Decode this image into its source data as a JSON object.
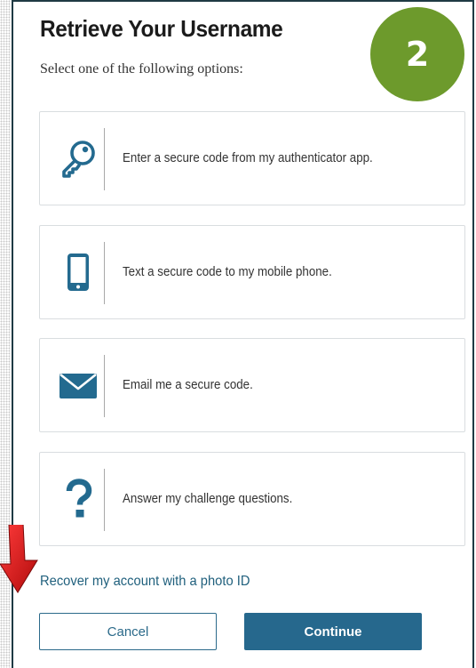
{
  "title": "Retrieve Your Username",
  "subtitle": "Select one of the following options:",
  "step_badge": "2",
  "options": [
    {
      "icon": "key-icon",
      "label": "Enter a secure code from my authenticator app."
    },
    {
      "icon": "mobile-phone-icon",
      "label": "Text a secure code to my mobile phone."
    },
    {
      "icon": "envelope-icon",
      "label": "Email me a secure code."
    },
    {
      "icon": "question-mark-icon",
      "label": "Answer my challenge questions."
    }
  ],
  "photo_id_link": "Recover my account with a photo ID",
  "buttons": {
    "cancel": "Cancel",
    "continue": "Continue"
  },
  "colors": {
    "accent": "#26688d",
    "badge": "#6d9a2c",
    "annotation_arrow": "#d11a1a"
  }
}
